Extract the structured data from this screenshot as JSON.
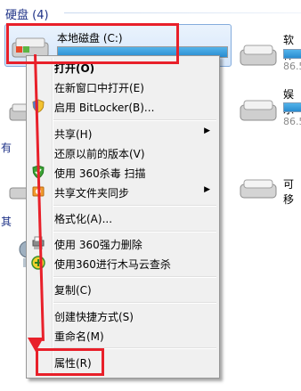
{
  "section": {
    "title": "硬盘 (4)"
  },
  "side_headings": [
    "有",
    "其"
  ],
  "selected_drive": {
    "label": "本地磁盘 (C:)"
  },
  "right_items": [
    {
      "label": "软件",
      "size": "86.5"
    },
    {
      "label": "娱乐",
      "size": "86.5"
    },
    {
      "label": "可移"
    }
  ],
  "context_menu": {
    "items": [
      {
        "label": "打开(O)"
      },
      {
        "label": "在新窗口中打开(E)"
      },
      {
        "label": "启用 BitLocker(B)..."
      },
      {
        "label": "共享(H)"
      },
      {
        "label": "还原以前的版本(V)"
      },
      {
        "label": "使用 360杀毒 扫描"
      },
      {
        "label": "共享文件夹同步"
      },
      {
        "label": "格式化(A)..."
      },
      {
        "label": "使用 360强力删除"
      },
      {
        "label": "使用360进行木马云查杀"
      },
      {
        "label": "复制(C)"
      },
      {
        "label": "创建快捷方式(S)"
      },
      {
        "label": "重命名(M)"
      },
      {
        "label": "属性(R)"
      }
    ]
  },
  "colors": {
    "annotation": "#e8202a",
    "header": "#1e3287"
  }
}
